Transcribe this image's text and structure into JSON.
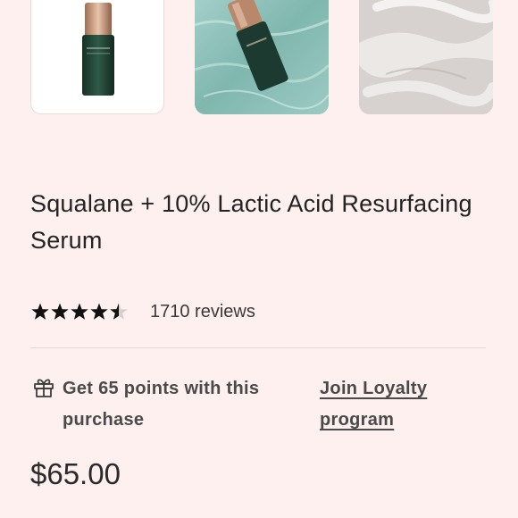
{
  "product": {
    "title": "Squalane + 10% Lactic Acid Resurfacing Serum",
    "rating": 4.5,
    "rating_max": 5,
    "reviews_text": "1710 reviews",
    "price": "$65.00"
  },
  "loyalty": {
    "points_text": "Get 65 points with this purchase",
    "join_link": "Join Loyalty program"
  },
  "gallery": {
    "thumbnails": [
      {
        "subject": "serum bottle on white background"
      },
      {
        "subject": "serum bottle in water"
      },
      {
        "subject": "cream texture swatch"
      }
    ]
  },
  "colors": {
    "background": "#fdf0ee",
    "bottle_green": "#1f3f33",
    "bottle_cap": "#b88a6b"
  },
  "icons": {
    "rating": "star-rating-icon",
    "points": "gift-icon"
  }
}
